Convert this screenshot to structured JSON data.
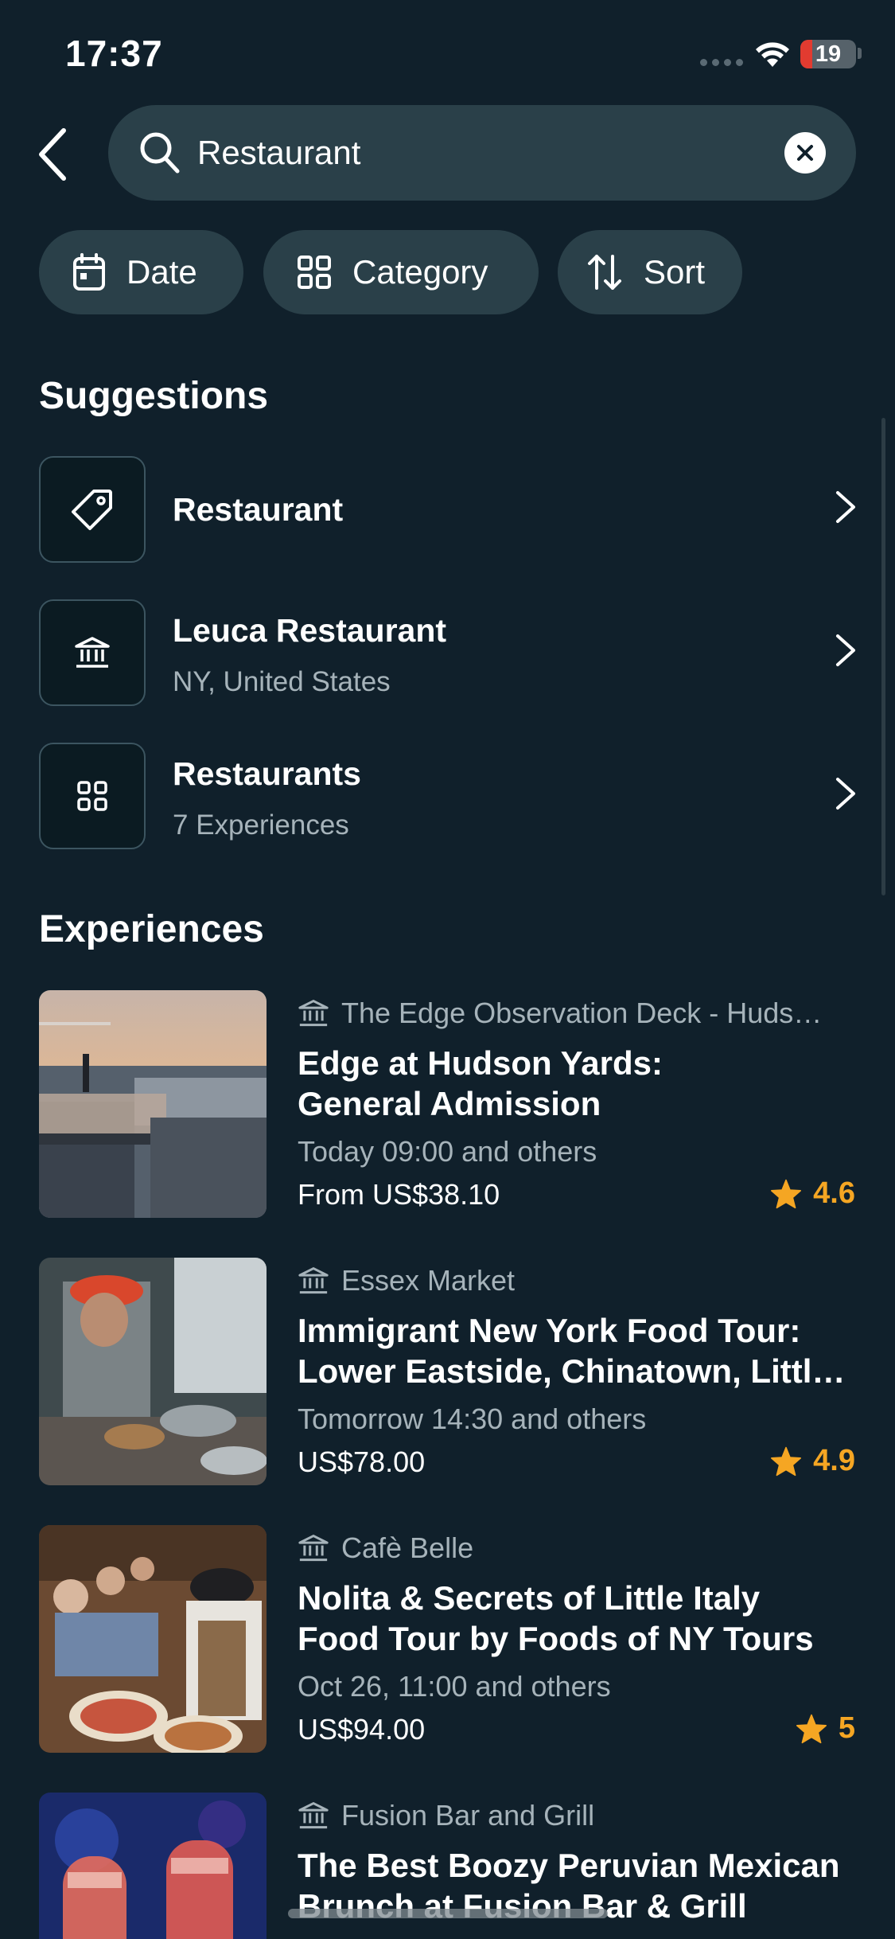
{
  "status_bar": {
    "time": "17:37",
    "battery": "19"
  },
  "search": {
    "value": "Restaurant"
  },
  "filters": [
    {
      "label": "Date",
      "icon": "calendar-icon"
    },
    {
      "label": "Category",
      "icon": "grid-icon"
    },
    {
      "label": "Sort",
      "icon": "sort-icon"
    }
  ],
  "suggestions": {
    "heading": "Suggestions",
    "items": [
      {
        "title": "Restaurant",
        "subtitle": "",
        "icon": "tag-icon"
      },
      {
        "title": "Leuca Restaurant",
        "subtitle": "NY, United States",
        "icon": "landmark-icon"
      },
      {
        "title": "Restaurants",
        "subtitle": "7 Experiences",
        "icon": "grid-icon"
      }
    ]
  },
  "experiences": {
    "heading": "Experiences",
    "items": [
      {
        "venue": "The Edge Observation Deck - Huds…",
        "title_line1": "Edge at Hudson Yards:",
        "title_line2": "General Admission",
        "date": "Today 09:00 and others",
        "price": "From US$38.10",
        "rating": "4.6"
      },
      {
        "venue": "Essex Market",
        "title_line1": "Immigrant New York Food Tour:",
        "title_line2": "Lower Eastside, Chinatown, Littl…",
        "date": "Tomorrow 14:30 and others",
        "price": "US$78.00",
        "rating": "4.9"
      },
      {
        "venue": "Cafè Belle",
        "title_line1": "Nolita & Secrets of Little Italy",
        "title_line2": "Food Tour by Foods of NY Tours",
        "date": "Oct 26, 11:00 and others",
        "price": "US$94.00",
        "rating": "5"
      },
      {
        "venue": "Fusion Bar and Grill",
        "title_line1": "The Best Boozy Peruvian Mexican",
        "title_line2": "Brunch at Fusion Bar & Grill",
        "date": "",
        "price": "",
        "rating": ""
      }
    ]
  },
  "colors": {
    "background": "#10202b",
    "chip": "#2a4049",
    "rating": "#f5a623",
    "muted_text": "#a6b3ba"
  }
}
